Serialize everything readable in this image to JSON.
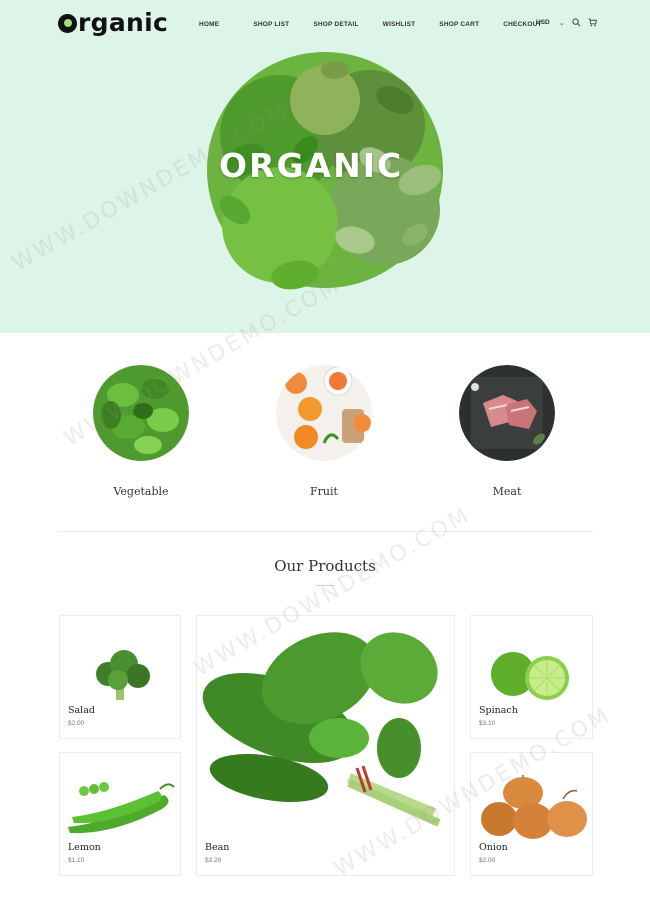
{
  "header": {
    "logo": "Organic",
    "nav": [
      "HOME",
      "SHOP LIST",
      "SHOP DETAIL",
      "WISHLIST",
      "SHOP CART",
      "CHECKOUT"
    ],
    "currency": "USD",
    "icons": [
      "chevron-down-icon",
      "search-icon",
      "cart-icon"
    ]
  },
  "hero": {
    "headline": "ORGANIC",
    "background": "#dcf5e8"
  },
  "categories": [
    {
      "label": "Vegetable"
    },
    {
      "label": "Fruit"
    },
    {
      "label": "Meat"
    }
  ],
  "products_section": {
    "title": "Our Products",
    "items": [
      {
        "name": "Salad",
        "price": "$2.00"
      },
      {
        "name": "Lemon",
        "price": "$1.10"
      },
      {
        "name": "Bean",
        "price": "$3.20"
      },
      {
        "name": "Spinach",
        "price": "$3.10"
      },
      {
        "name": "Onion",
        "price": "$2.00"
      }
    ]
  },
  "watermark": "WWW.DOWNDEMO.COM"
}
